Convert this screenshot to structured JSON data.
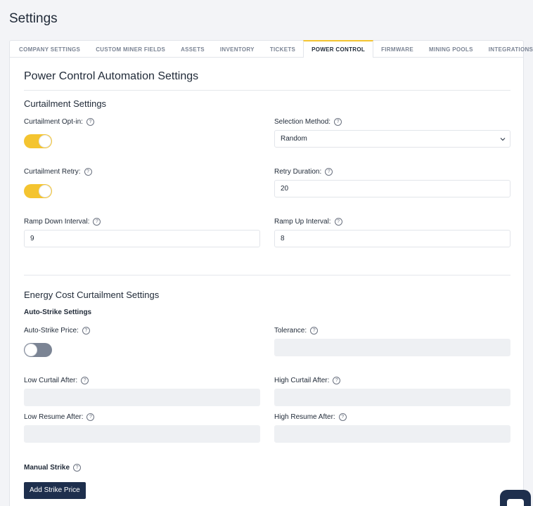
{
  "page": {
    "title": "Settings"
  },
  "tabs": [
    {
      "label": "COMPANY SETTINGS",
      "active": false
    },
    {
      "label": "CUSTOM MINER FIELDS",
      "active": false
    },
    {
      "label": "ASSETS",
      "active": false
    },
    {
      "label": "INVENTORY",
      "active": false
    },
    {
      "label": "TICKETS",
      "active": false
    },
    {
      "label": "POWER CONTROL",
      "active": true
    },
    {
      "label": "FIRMWARE",
      "active": false
    },
    {
      "label": "MINING POOLS",
      "active": false
    },
    {
      "label": "INTEGRATIONS",
      "active": false
    }
  ],
  "main": {
    "heading": "Power Control Automation Settings",
    "curtailment": {
      "heading": "Curtailment Settings",
      "opt_in": {
        "label": "Curtailment Opt-in:",
        "enabled": true
      },
      "selection_method": {
        "label": "Selection Method:",
        "value": "Random"
      },
      "retry": {
        "label": "Curtailment Retry:",
        "enabled": true
      },
      "retry_duration": {
        "label": "Retry Duration:",
        "value": "20"
      },
      "ramp_down": {
        "label": "Ramp Down Interval:",
        "value": "9"
      },
      "ramp_up": {
        "label": "Ramp Up Interval:",
        "value": "8"
      }
    },
    "energy": {
      "heading": "Energy Cost Curtailment Settings",
      "auto_strike_heading": "Auto-Strike Settings",
      "auto_strike_price": {
        "label": "Auto-Strike Price:",
        "enabled": false
      },
      "tolerance": {
        "label": "Tolerance:",
        "value": ""
      },
      "low_curtail": {
        "label": "Low Curtail After:",
        "value": ""
      },
      "high_curtail": {
        "label": "High Curtail After:",
        "value": ""
      },
      "low_resume": {
        "label": "Low Resume After:",
        "value": ""
      },
      "high_resume": {
        "label": "High Resume After:",
        "value": ""
      },
      "manual_strike_heading": "Manual Strike",
      "add_strike_label": "Add Strike Price"
    }
  },
  "help_glyph": "?",
  "colors": {
    "accent": "#f4c430",
    "primary_button": "#1e2f4d",
    "toggle_off": "#7b8494"
  },
  "icons": {
    "help": "help-circle-icon",
    "chevron": "chevron-down-icon",
    "chat": "chat-icon"
  }
}
